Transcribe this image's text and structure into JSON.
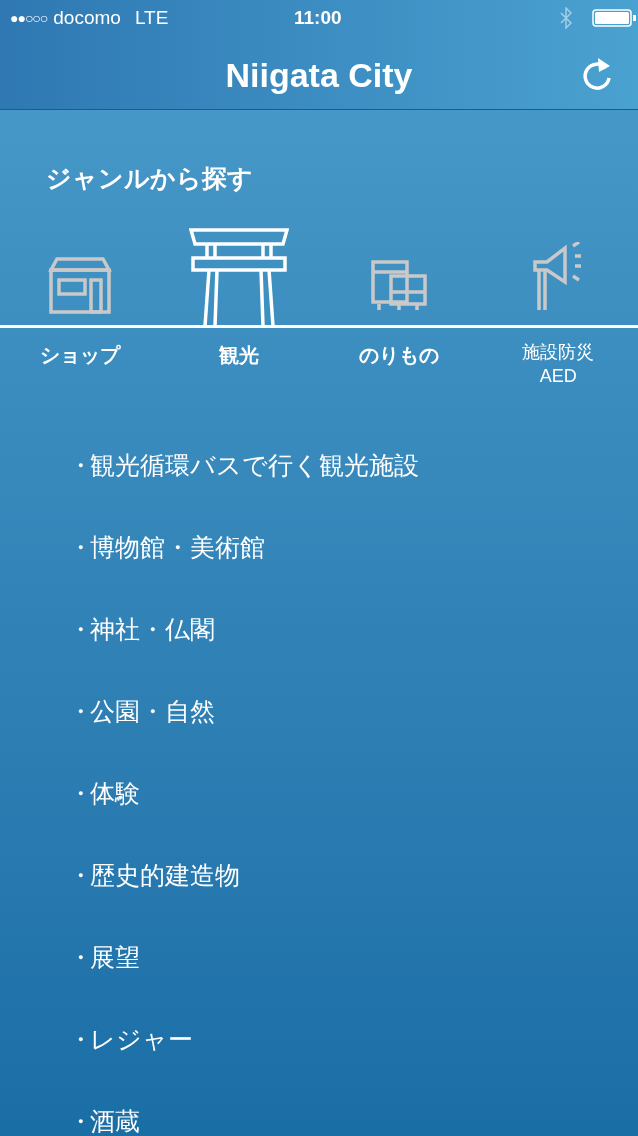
{
  "status_bar": {
    "signal": "●●○○○",
    "carrier": "docomo",
    "network": "LTE",
    "time": "11:00"
  },
  "header": {
    "title": "Niigata City"
  },
  "genre_section": {
    "title": "ジャンルから探す",
    "genres": [
      {
        "kind": "shop",
        "label": "ショップ",
        "selected": false
      },
      {
        "kind": "torii",
        "label": "観光",
        "selected": true
      },
      {
        "kind": "vehicle",
        "label": "のりもの",
        "selected": false
      },
      {
        "kind": "megaphone",
        "label": "施設防災\nAED",
        "selected": false
      }
    ]
  },
  "category_list": [
    {
      "bullet": "・",
      "label": "観光循環バスで行く観光施設"
    },
    {
      "bullet": "・",
      "label": "博物館・美術館"
    },
    {
      "bullet": "・",
      "label": "神社・仏閣"
    },
    {
      "bullet": "・",
      "label": "公園・自然"
    },
    {
      "bullet": "・",
      "label": "体験"
    },
    {
      "bullet": "・",
      "label": "歴史的建造物"
    },
    {
      "bullet": "・",
      "label": "展望"
    },
    {
      "bullet": "・",
      "label": "レジャー"
    },
    {
      "bullet": "・",
      "label": "酒蔵"
    }
  ]
}
